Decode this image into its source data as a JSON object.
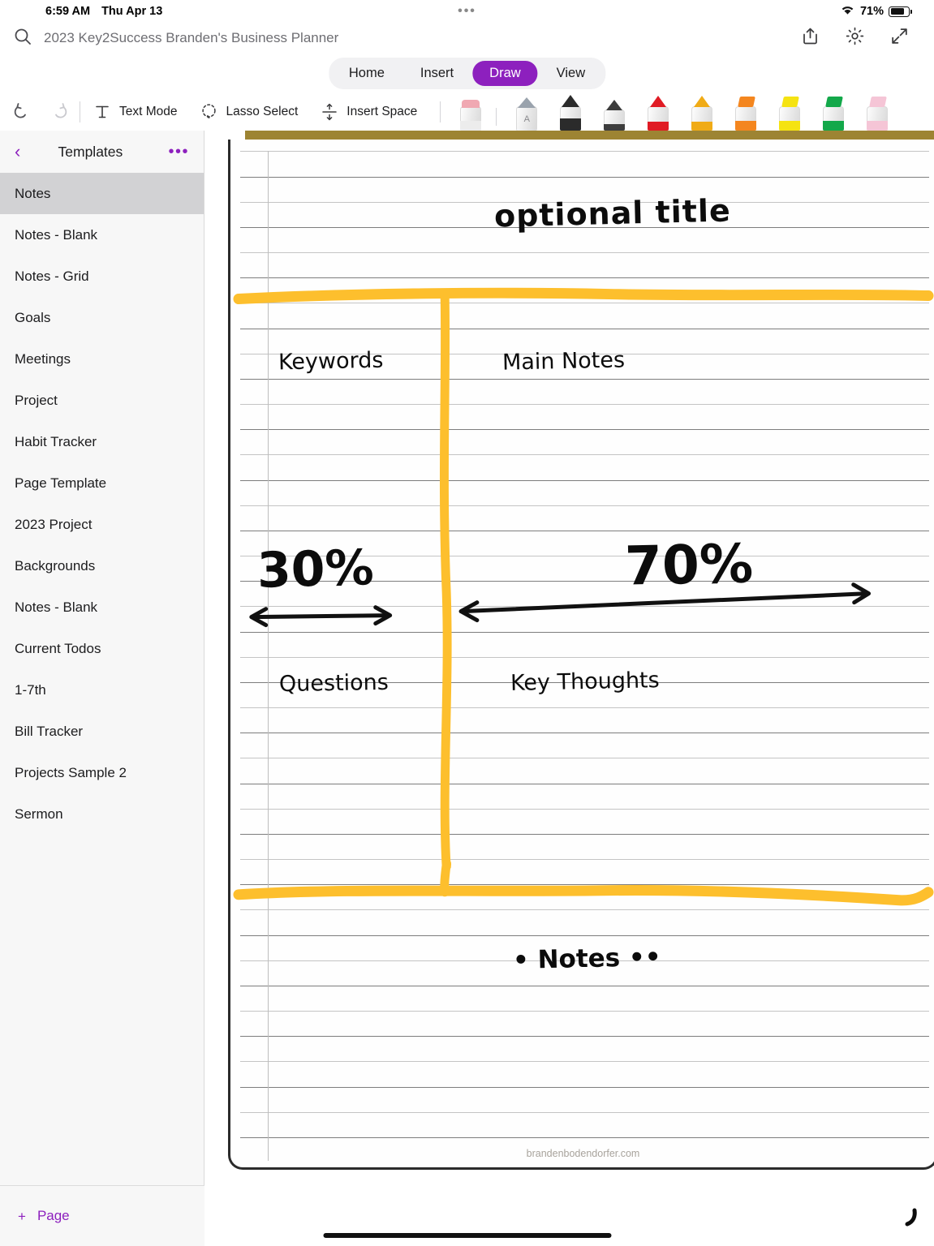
{
  "statusbar": {
    "time": "6:59 AM",
    "date": "Thu Apr 13",
    "center_dots": "•••",
    "wifi_icon": "wifi-icon",
    "battery_percent": "71%",
    "battery_icon": "battery-icon"
  },
  "titlebar": {
    "search_icon": "search-icon",
    "document_title": "2023 Key2Success Branden's Business Planner",
    "share_icon": "share-icon",
    "settings_icon": "gear-icon",
    "expand_icon": "expand-icon"
  },
  "tabs": {
    "items": [
      {
        "label": "Home",
        "active": false
      },
      {
        "label": "Insert",
        "active": false
      },
      {
        "label": "Draw",
        "active": true
      },
      {
        "label": "View",
        "active": false
      }
    ],
    "active_color": "#8D20BE"
  },
  "toolbar": {
    "undo_label": "undo-icon",
    "redo_label": "redo-icon",
    "text_mode": "Text Mode",
    "lasso_select": "Lasso Select",
    "insert_space": "Insert Space",
    "pens": [
      {
        "name": "eraser-tool",
        "tip": "#f0a8b2",
        "band": "#e9e9e9",
        "letter": ""
      },
      {
        "name": "text-pen-tool",
        "tip": "#9aa3ad",
        "band": "#e4e4e4",
        "letter": "A"
      },
      {
        "name": "black-marker-tool",
        "tip": "#2b2b2b",
        "band": "#2b2b2b",
        "letter": ""
      },
      {
        "name": "dark-gray-pen-tool",
        "tip": "#3d3d3d",
        "band": "#3d3d3d",
        "letter": ""
      },
      {
        "name": "red-pen-tool",
        "tip": "#e01b24",
        "band": "#e01b24",
        "letter": ""
      },
      {
        "name": "amber-pen-tool",
        "tip": "#f0ab16",
        "band": "#f0ab16",
        "letter": ""
      },
      {
        "name": "orange-highlighter-tool",
        "tip": "#f4861f",
        "band": "#f4861f",
        "letter": ""
      },
      {
        "name": "yellow-highlighter-tool",
        "tip": "#f5e312",
        "band": "#f5e312",
        "letter": ""
      },
      {
        "name": "green-highlighter-tool",
        "tip": "#13a84a",
        "band": "#13a84a",
        "letter": ""
      },
      {
        "name": "pink-highlighter-tool",
        "tip": "#f5c5d6",
        "band": "#f5c5d6",
        "letter": ""
      }
    ]
  },
  "sidebar": {
    "back_icon": "chevron-left-icon",
    "title": "Templates",
    "more_icon": "ellipsis-icon",
    "items": [
      {
        "label": "Notes",
        "selected": true
      },
      {
        "label": "Notes - Blank",
        "selected": false
      },
      {
        "label": "Notes - Grid",
        "selected": false
      },
      {
        "label": "Goals",
        "selected": false
      },
      {
        "label": "Meetings",
        "selected": false
      },
      {
        "label": "Project",
        "selected": false
      },
      {
        "label": "Habit Tracker",
        "selected": false
      },
      {
        "label": "Page Template",
        "selected": false
      },
      {
        "label": "2023 Project",
        "selected": false
      },
      {
        "label": "Backgrounds",
        "selected": false
      },
      {
        "label": "Notes - Blank",
        "selected": false
      },
      {
        "label": "Current Todos",
        "selected": false
      },
      {
        "label": "1-7th",
        "selected": false
      },
      {
        "label": "Bill Tracker",
        "selected": false
      },
      {
        "label": "Projects Sample 2",
        "selected": false
      },
      {
        "label": "Sermon",
        "selected": false
      }
    ],
    "add_page_label": "Page",
    "add_page_icon": "plus-icon",
    "accent_color": "#8D20BE"
  },
  "page": {
    "footer_watermark": "brandenbodendorfer.com",
    "rule_color_dark": "#7d7d7d",
    "rule_color_light": "#c4c4c4",
    "highlighter_color": "#FDBF2D",
    "ink_color": "#0c0c0c",
    "handwriting": [
      {
        "name": "optional-title-text",
        "text": "optional title"
      },
      {
        "name": "keywords-label-text",
        "text": "Keywords"
      },
      {
        "name": "main-notes-label-text",
        "text": "Main Notes"
      },
      {
        "name": "thirty-percent-text",
        "text": "30%"
      },
      {
        "name": "seventy-percent-text",
        "text": "70%"
      },
      {
        "name": "questions-label-text",
        "text": "Questions"
      },
      {
        "name": "key-thoughts-label-text",
        "text": "Key Thoughts"
      },
      {
        "name": "notes-label-text",
        "text": "• Notes ••"
      }
    ]
  }
}
